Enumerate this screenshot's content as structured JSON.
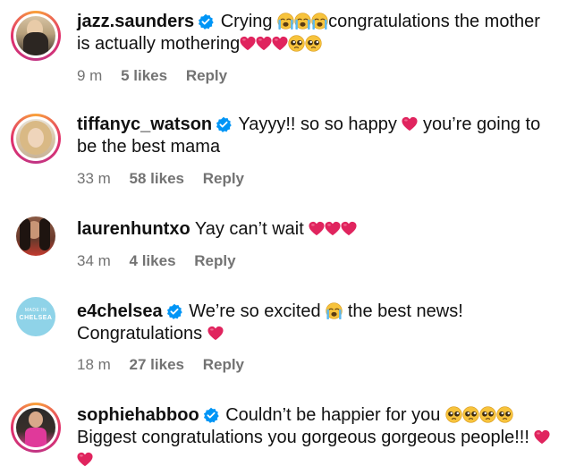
{
  "comments": [
    {
      "username": "jazz.saunders",
      "verified": true,
      "text_line1": "Crying",
      "text_line1b": "congratulations the mother",
      "text_line2": "is actually mothering",
      "time": "9 m",
      "likes": "5 likes",
      "reply": "Reply"
    },
    {
      "username": "tiffanyc_watson",
      "verified": true,
      "text_line1": "Yayyy!! so so happy",
      "text_line1b": "you’re going to",
      "text_line2": "be the best mama",
      "time": "33 m",
      "likes": "58 likes",
      "reply": "Reply"
    },
    {
      "username": "laurenhuntxo",
      "verified": false,
      "text_line1": "Yay can’t wait",
      "time": "34 m",
      "likes": "4 likes",
      "reply": "Reply"
    },
    {
      "username": "e4chelsea",
      "verified": true,
      "avatar_text_top": "MADE IN",
      "avatar_text_main": "CHELSEA",
      "text_line1": "We’re so excited",
      "text_line1b": "the best news!",
      "text_line2": "Congratulations",
      "time": "18 m",
      "likes": "27 likes",
      "reply": "Reply"
    },
    {
      "username": "sophiehabboo",
      "verified": true,
      "text_line1": "Couldn’t be happier for you",
      "text_line2": "Biggest congratulations you gorgeous gorgeous people!!!"
    }
  ],
  "colors": {
    "verified": "#0095f6",
    "heart": "#e0245e",
    "meta": "#737373",
    "e4chelsea_bg": "#8fd3e8"
  },
  "icons": [
    "verified-badge-icon",
    "red-heart-emoji",
    "crying-face-emoji",
    "pleading-face-emoji"
  ]
}
